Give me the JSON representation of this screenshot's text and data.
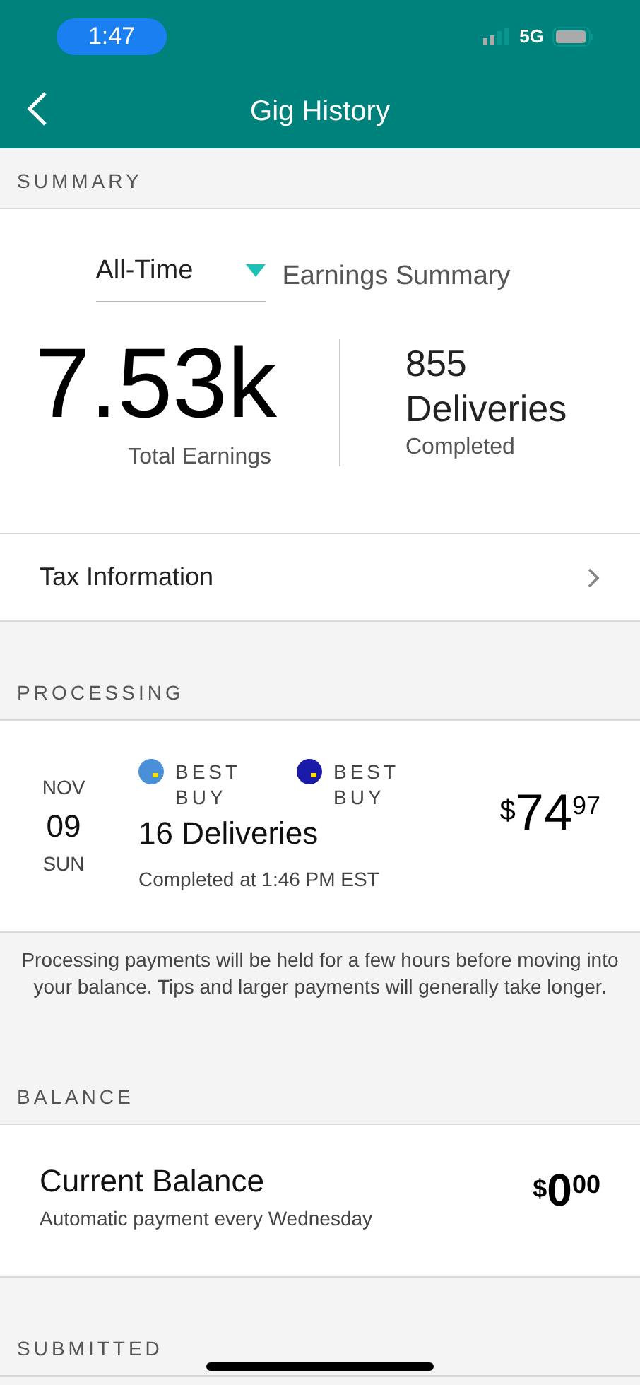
{
  "status_bar": {
    "time": "1:47",
    "network": "5G"
  },
  "header": {
    "title": "Gig History"
  },
  "summary": {
    "label": "SUMMARY",
    "period": "All-Time",
    "heading": "Earnings Summary",
    "earnings": "7.53k",
    "earnings_label": "Total Earnings",
    "deliveries_count": "855",
    "deliveries_label": "Deliveries",
    "deliveries_sub": "Completed"
  },
  "tax_row": {
    "label": "Tax Information"
  },
  "processing": {
    "label": "PROCESSING",
    "items": [
      {
        "month": "NOV",
        "day": "09",
        "weekday": "SUN",
        "stores": [
          {
            "name": "BEST BUY",
            "color": "#4a90d9"
          },
          {
            "name": "BEST BUY",
            "color": "#1a1aa8"
          }
        ],
        "title": "16 Deliveries",
        "subtitle": "Completed at 1:46 PM EST",
        "currency": "$",
        "whole": "74",
        "cents": "97"
      }
    ],
    "note": "Processing payments will be held for a few hours before moving into your balance. Tips and larger payments will generally take longer."
  },
  "balance": {
    "label": "BALANCE",
    "title": "Current Balance",
    "subtitle": "Automatic payment every Wednesday",
    "currency": "$",
    "whole": "0",
    "cents": "00"
  },
  "submitted": {
    "label": "SUBMITTED"
  }
}
